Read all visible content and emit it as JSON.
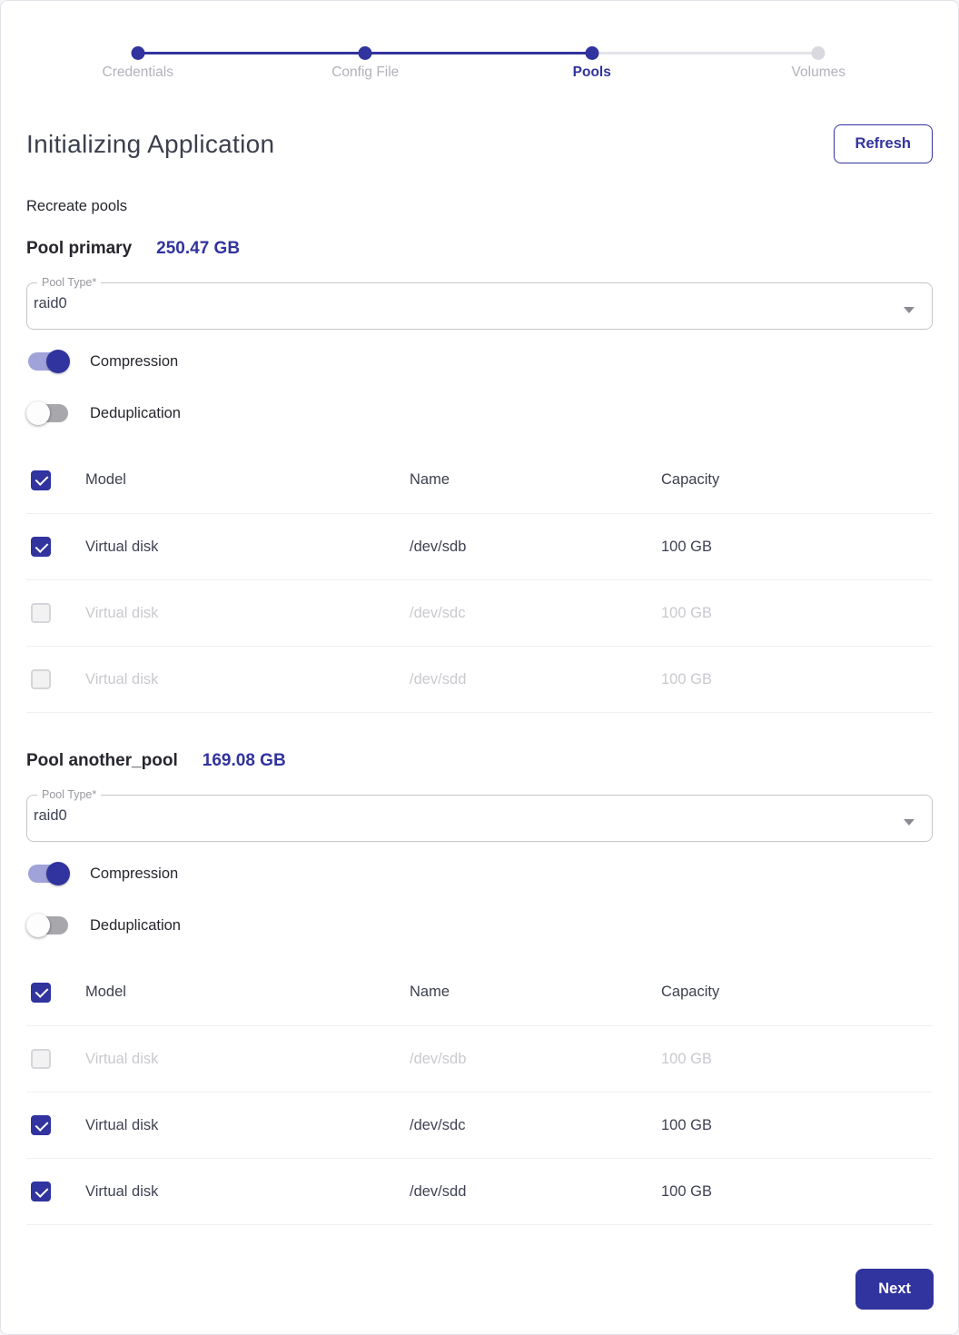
{
  "stepper": {
    "steps": [
      {
        "label": "Credentials",
        "state": "completed"
      },
      {
        "label": "Config File",
        "state": "completed"
      },
      {
        "label": "Pools",
        "state": "active"
      },
      {
        "label": "Volumes",
        "state": "upcoming"
      }
    ]
  },
  "header": {
    "title": "Initializing Application",
    "refresh_label": "Refresh"
  },
  "subtitle": "Recreate pools",
  "table_headers": {
    "model": "Model",
    "name": "Name",
    "capacity": "Capacity"
  },
  "pools": [
    {
      "name": "Pool primary",
      "size": "250.47 GB",
      "pool_type_label": "Pool Type*",
      "pool_type_value": "raid0",
      "compression_label": "Compression",
      "compression_on": true,
      "deduplication_label": "Deduplication",
      "deduplication_on": false,
      "header_checked": true,
      "rows": [
        {
          "model": "Virtual disk",
          "name": "/dev/sdb",
          "capacity": "100 GB",
          "checked": true,
          "disabled": false
        },
        {
          "model": "Virtual disk",
          "name": "/dev/sdc",
          "capacity": "100 GB",
          "checked": false,
          "disabled": true
        },
        {
          "model": "Virtual disk",
          "name": "/dev/sdd",
          "capacity": "100 GB",
          "checked": false,
          "disabled": true
        }
      ]
    },
    {
      "name": "Pool another_pool",
      "size": "169.08 GB",
      "pool_type_label": "Pool Type*",
      "pool_type_value": "raid0",
      "compression_label": "Compression",
      "compression_on": true,
      "deduplication_label": "Deduplication",
      "deduplication_on": false,
      "header_checked": true,
      "rows": [
        {
          "model": "Virtual disk",
          "name": "/dev/sdb",
          "capacity": "100 GB",
          "checked": false,
          "disabled": true
        },
        {
          "model": "Virtual disk",
          "name": "/dev/sdc",
          "capacity": "100 GB",
          "checked": true,
          "disabled": false
        },
        {
          "model": "Virtual disk",
          "name": "/dev/sdd",
          "capacity": "100 GB",
          "checked": true,
          "disabled": false
        }
      ]
    }
  ],
  "footer": {
    "next_label": "Next"
  },
  "colors": {
    "primary": "#31339E",
    "switch_on_track": "#9FA3D9",
    "step_inactive": "#B2B2BC",
    "disabled_text": "#C9C9CF",
    "divider": "#EFEFF1"
  }
}
